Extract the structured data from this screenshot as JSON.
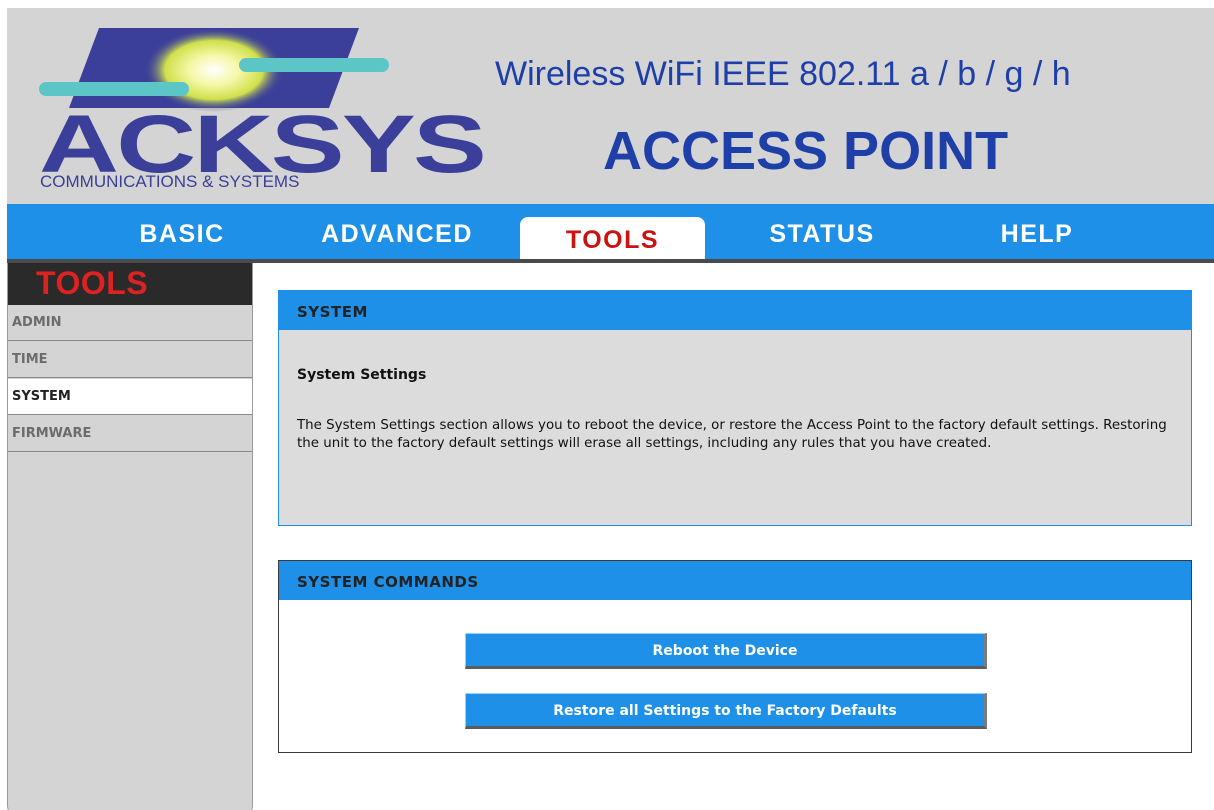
{
  "header": {
    "logo_text": "ACKSYS",
    "logo_subtitle": "COMMUNICATIONS & SYSTEMS",
    "subtitle": "Wireless WiFi IEEE 802.11 a / b / g / h",
    "title": "ACCESS POINT"
  },
  "nav": {
    "tabs": [
      {
        "label": "BASIC"
      },
      {
        "label": "ADVANCED"
      },
      {
        "label": "TOOLS"
      },
      {
        "label": "STATUS"
      },
      {
        "label": "HELP"
      }
    ],
    "active": "TOOLS"
  },
  "sidebar": {
    "heading": "TOOLS",
    "items": [
      {
        "label": "ADMIN"
      },
      {
        "label": "TIME"
      },
      {
        "label": "SYSTEM"
      },
      {
        "label": "FIRMWARE"
      }
    ],
    "active": "SYSTEM"
  },
  "system_panel": {
    "title": "SYSTEM",
    "subheading": "System Settings",
    "description": "The System Settings section allows you to reboot the device, or restore the Access Point to the factory default settings. Restoring the unit to the factory default settings will erase all settings, including any rules that you have created."
  },
  "commands_panel": {
    "title": "SYSTEM COMMANDS",
    "reboot_label": "Reboot the Device",
    "restore_label": "Restore all Settings to the Factory Defaults"
  },
  "colors": {
    "accent_blue": "#1e90e8",
    "active_tab_red": "#cc1111",
    "logo_blue": "#3b3f99",
    "header_text_blue": "#1f3fa8",
    "header_bg": "#d4d4d4"
  }
}
